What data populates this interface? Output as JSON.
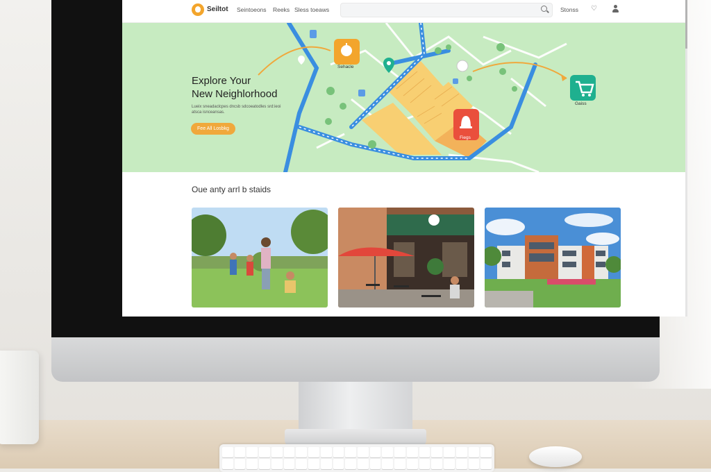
{
  "nav": {
    "logo_text": "Seiltot",
    "links": [
      "Seintoeons",
      "Reeks",
      "Sless toeaws"
    ],
    "right_link": "Stonss",
    "search_placeholder": ""
  },
  "hero": {
    "title_line1": "Explore Your",
    "title_line2": "New Neighlorhood",
    "subtitle": "Lueix sneadaclcpes dncsb sdcoeatodles srd:ieoi atsca isnceansas.",
    "button_label": "Fee All Losbkg",
    "map_labels": {
      "school": "Sehacle",
      "shops": "Fiegs",
      "grocery": "Gaiss"
    }
  },
  "section": {
    "title": "Oue anty arrl b staids"
  },
  "cards": [
    {
      "subject": "children playing in park"
    },
    {
      "subject": "cafe with red umbrellas"
    },
    {
      "subject": "modern brick building"
    }
  ],
  "colors": {
    "map_green": "#c7ebc1",
    "road_blue": "#3a8ee0",
    "block_yellow": "#f8cf72",
    "accent_orange": "#f0a83c",
    "red_pin": "#ea4f3c",
    "teal_pin": "#1fb08f"
  },
  "icons": {
    "logo": "logo-icon",
    "search": "search-icon",
    "favorites": "heart-icon",
    "account": "user-icon",
    "school_pin": "apple-icon",
    "shops_pin": "bell-icon",
    "grocery_pin": "cart-icon",
    "location_pin": "location-pin-icon"
  }
}
